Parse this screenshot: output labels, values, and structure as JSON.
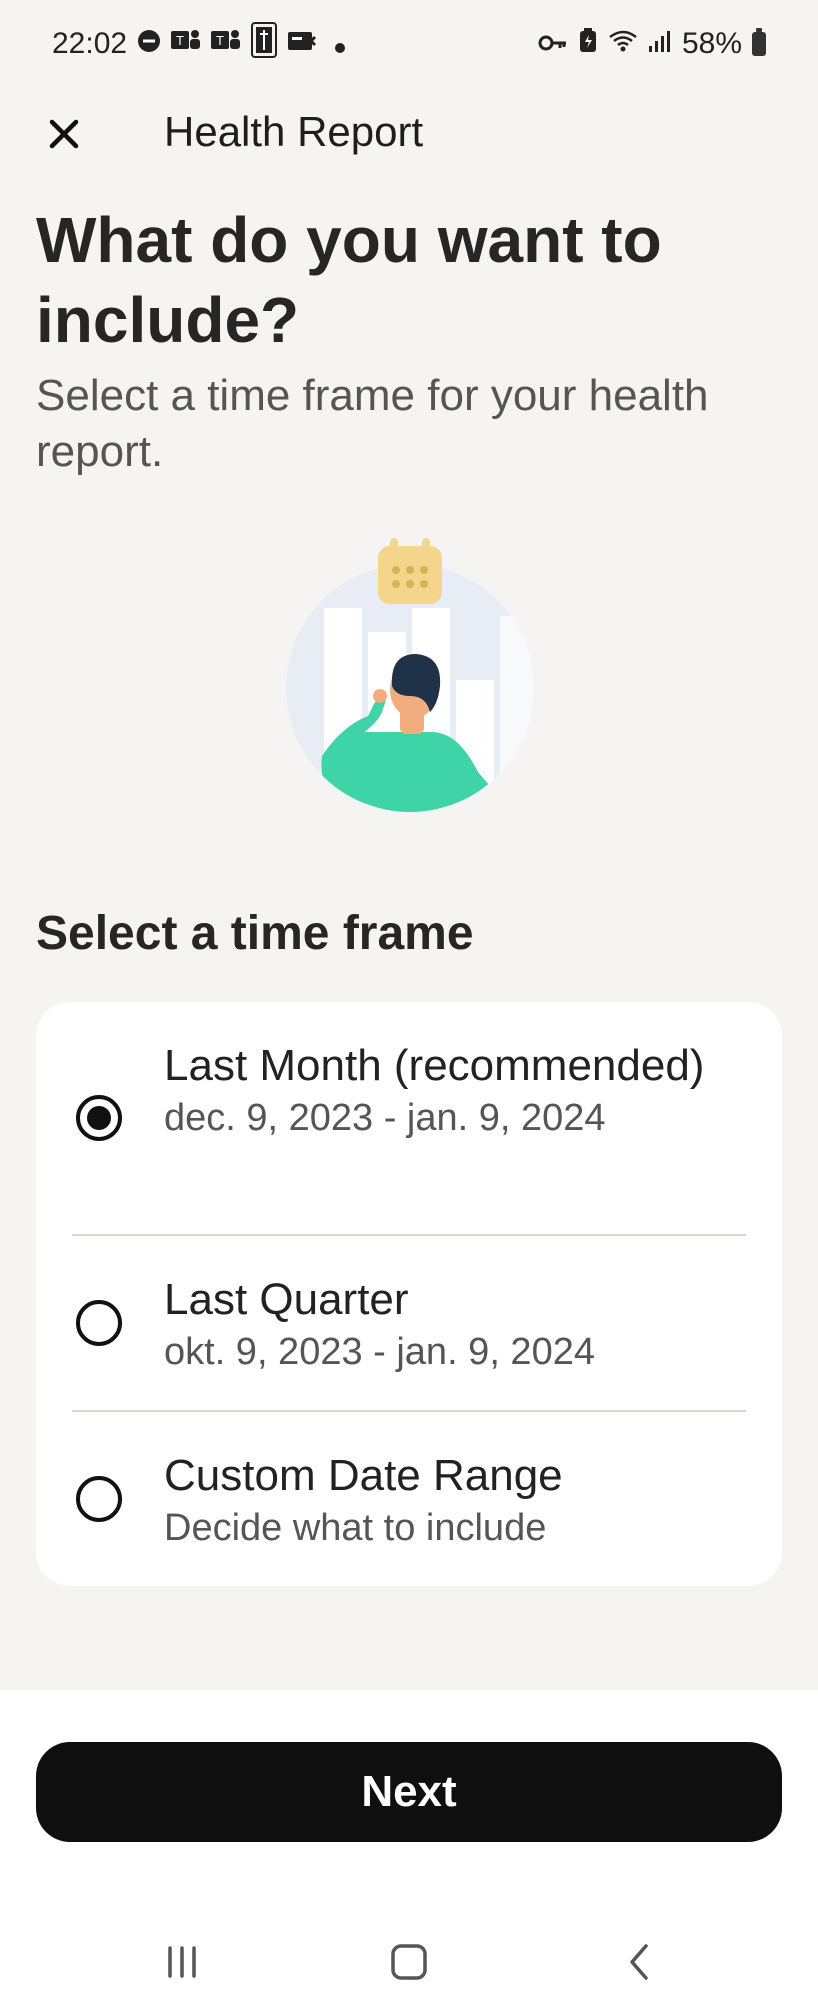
{
  "status_bar": {
    "time": "22:02",
    "battery": "58%",
    "icons_left": [
      "do-not-disturb-icon",
      "teams-icon",
      "teams-icon",
      "pga-app-icon",
      "card-icon",
      "notification-dot-icon"
    ],
    "icons_right": [
      "key-icon",
      "battery-saver-icon",
      "wifi-icon",
      "signal-icon",
      "battery-icon"
    ]
  },
  "header": {
    "title": "Health Report",
    "close_icon": "close-icon"
  },
  "intro": {
    "title": "What do you want to include?",
    "subtitle": "Select a time frame for your health report."
  },
  "illustration": {
    "icon": "health-report-illustration",
    "colors": {
      "circle": "#e8edf5",
      "bars": "#ffffff",
      "calendar": "#f3d58b",
      "shirt": "#3fd4a8",
      "hair": "#1f3247",
      "skin": "#f1ad7e"
    }
  },
  "time_frame": {
    "section_title": "Select a time frame",
    "options": [
      {
        "label": "Last Month (recommended)",
        "sub": "dec. 9, 2023 - jan. 9, 2024",
        "selected": true
      },
      {
        "label": "Last Quarter",
        "sub": "okt. 9, 2023 - jan. 9, 2024",
        "selected": false
      },
      {
        "label": "Custom Date Range",
        "sub": "Decide what to include",
        "selected": false
      }
    ]
  },
  "footer": {
    "next_label": "Next"
  },
  "nav_bar": {
    "icons": [
      "recent-apps-icon",
      "home-icon",
      "back-icon"
    ]
  },
  "colors": {
    "background": "#f5f4f2",
    "card": "#ffffff",
    "primary_button": "#0f0f0f",
    "text": "#222222",
    "muted_text": "#555555"
  }
}
